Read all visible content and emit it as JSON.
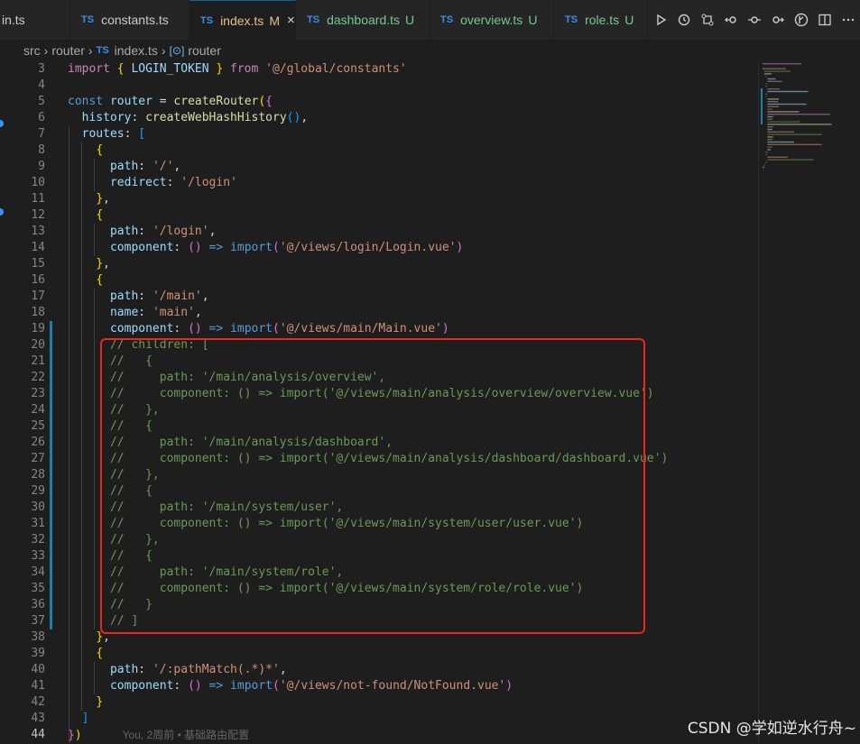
{
  "tabs": [
    {
      "name": "in.ts",
      "prefix": "",
      "status": "",
      "status_color": "#cccccc",
      "active": false
    },
    {
      "name": "constants.ts",
      "prefix": "TS",
      "status": "",
      "status_color": "#cccccc",
      "active": false
    },
    {
      "name": "index.ts",
      "prefix": "TS",
      "status": "M",
      "status_color": "#e2c08d",
      "active": true
    },
    {
      "name": "dashboard.ts",
      "prefix": "TS",
      "status": "U",
      "status_color": "#73c991",
      "active": false
    },
    {
      "name": "overview.ts",
      "prefix": "TS",
      "status": "U",
      "status_color": "#73c991",
      "active": false
    },
    {
      "name": "role.ts",
      "prefix": "TS",
      "status": "U",
      "status_color": "#73c991",
      "active": false
    }
  ],
  "tab_close": "×",
  "breadcrumb": {
    "folder1": "src",
    "folder2": "router",
    "file_prefix": "TS",
    "file": "index.ts",
    "symbol_icon": "[⊙]",
    "symbol": "router"
  },
  "toolbar": [
    "run-icon",
    "history-icon",
    "compare-icon",
    "back-icon",
    "commit-icon",
    "forward-icon",
    "git-graph-icon",
    "split-icon",
    "more-icon"
  ],
  "lines": [
    {
      "n": "3",
      "t": [
        [
          "kw",
          "import "
        ],
        [
          "b1",
          "{ "
        ],
        [
          "v",
          "LOGIN_TOKEN"
        ],
        [
          "b1",
          " }"
        ],
        [
          "kw",
          " from "
        ],
        [
          "s",
          "'@/global/constants'"
        ]
      ]
    },
    {
      "n": "4",
      "t": []
    },
    {
      "n": "5",
      "t": [
        [
          "k",
          "const "
        ],
        [
          "v",
          "router"
        ],
        [
          "p",
          " = "
        ],
        [
          "f",
          "createRouter"
        ],
        [
          "b1",
          "("
        ],
        [
          "b2",
          "{"
        ]
      ]
    },
    {
      "n": "6",
      "t": [
        [
          "p",
          "  "
        ],
        [
          "v",
          "history"
        ],
        [
          "p",
          ": "
        ],
        [
          "f",
          "createWebHashHistory"
        ],
        [
          "b3",
          "()"
        ],
        [
          "p",
          ","
        ]
      ]
    },
    {
      "n": "7",
      "t": [
        [
          "p",
          "  "
        ],
        [
          "v",
          "routes"
        ],
        [
          "p",
          ": "
        ],
        [
          "b3",
          "["
        ]
      ]
    },
    {
      "n": "8",
      "t": [
        [
          "p",
          "    "
        ],
        [
          "b1",
          "{"
        ]
      ]
    },
    {
      "n": "9",
      "t": [
        [
          "p",
          "      "
        ],
        [
          "v",
          "path"
        ],
        [
          "p",
          ": "
        ],
        [
          "s",
          "'/'"
        ],
        [
          "p",
          ","
        ]
      ]
    },
    {
      "n": "10",
      "t": [
        [
          "p",
          "      "
        ],
        [
          "v",
          "redirect"
        ],
        [
          "p",
          ": "
        ],
        [
          "s",
          "'/login'"
        ]
      ]
    },
    {
      "n": "11",
      "t": [
        [
          "p",
          "    "
        ],
        [
          "b1",
          "}"
        ],
        [
          "p",
          ","
        ]
      ]
    },
    {
      "n": "12",
      "t": [
        [
          "p",
          "    "
        ],
        [
          "b1",
          "{"
        ]
      ]
    },
    {
      "n": "13",
      "t": [
        [
          "p",
          "      "
        ],
        [
          "v",
          "path"
        ],
        [
          "p",
          ": "
        ],
        [
          "s",
          "'/login'"
        ],
        [
          "p",
          ","
        ]
      ]
    },
    {
      "n": "14",
      "t": [
        [
          "p",
          "      "
        ],
        [
          "v",
          "component"
        ],
        [
          "p",
          ": "
        ],
        [
          "b2",
          "()"
        ],
        [
          "k",
          " => "
        ],
        [
          "k",
          "import"
        ],
        [
          "b2",
          "("
        ],
        [
          "s",
          "'@/views/login/Login.vue'"
        ],
        [
          "b2",
          ")"
        ]
      ]
    },
    {
      "n": "15",
      "t": [
        [
          "p",
          "    "
        ],
        [
          "b1",
          "}"
        ],
        [
          "p",
          ","
        ]
      ]
    },
    {
      "n": "16",
      "t": [
        [
          "p",
          "    "
        ],
        [
          "b1",
          "{"
        ]
      ]
    },
    {
      "n": "17",
      "t": [
        [
          "p",
          "      "
        ],
        [
          "v",
          "path"
        ],
        [
          "p",
          ": "
        ],
        [
          "s",
          "'/main'"
        ],
        [
          "p",
          ","
        ]
      ]
    },
    {
      "n": "18",
      "t": [
        [
          "p",
          "      "
        ],
        [
          "v",
          "name"
        ],
        [
          "p",
          ": "
        ],
        [
          "s",
          "'main'"
        ],
        [
          "p",
          ","
        ]
      ]
    },
    {
      "n": "19",
      "t": [
        [
          "p",
          "      "
        ],
        [
          "v",
          "component"
        ],
        [
          "p",
          ": "
        ],
        [
          "b2",
          "()"
        ],
        [
          "k",
          " => "
        ],
        [
          "k",
          "import"
        ],
        [
          "b2",
          "("
        ],
        [
          "s",
          "'@/views/main/Main.vue'"
        ],
        [
          "b2",
          ")"
        ]
      ]
    },
    {
      "n": "20",
      "t": [
        [
          "p",
          "      "
        ],
        [
          "c",
          "// children: ["
        ]
      ]
    },
    {
      "n": "21",
      "t": [
        [
          "p",
          "      "
        ],
        [
          "c",
          "//   {"
        ]
      ]
    },
    {
      "n": "22",
      "t": [
        [
          "p",
          "      "
        ],
        [
          "c",
          "//     path: '/main/analysis/overview',"
        ]
      ]
    },
    {
      "n": "23",
      "t": [
        [
          "p",
          "      "
        ],
        [
          "c",
          "//     component: () => import('@/views/main/analysis/overview/overview.vue')"
        ]
      ]
    },
    {
      "n": "24",
      "t": [
        [
          "p",
          "      "
        ],
        [
          "c",
          "//   },"
        ]
      ]
    },
    {
      "n": "25",
      "t": [
        [
          "p",
          "      "
        ],
        [
          "c",
          "//   {"
        ]
      ]
    },
    {
      "n": "26",
      "t": [
        [
          "p",
          "      "
        ],
        [
          "c",
          "//     path: '/main/analysis/dashboard',"
        ]
      ]
    },
    {
      "n": "27",
      "t": [
        [
          "p",
          "      "
        ],
        [
          "c",
          "//     component: () => import('@/views/main/analysis/dashboard/dashboard.vue')"
        ]
      ]
    },
    {
      "n": "28",
      "t": [
        [
          "p",
          "      "
        ],
        [
          "c",
          "//   },"
        ]
      ]
    },
    {
      "n": "29",
      "t": [
        [
          "p",
          "      "
        ],
        [
          "c",
          "//   {"
        ]
      ]
    },
    {
      "n": "30",
      "t": [
        [
          "p",
          "      "
        ],
        [
          "c",
          "//     path: '/main/system/user',"
        ]
      ]
    },
    {
      "n": "31",
      "t": [
        [
          "p",
          "      "
        ],
        [
          "c",
          "//     component: () => import('@/views/main/system/user/user.vue')"
        ]
      ]
    },
    {
      "n": "32",
      "t": [
        [
          "p",
          "      "
        ],
        [
          "c",
          "//   },"
        ]
      ]
    },
    {
      "n": "33",
      "t": [
        [
          "p",
          "      "
        ],
        [
          "c",
          "//   {"
        ]
      ]
    },
    {
      "n": "34",
      "t": [
        [
          "p",
          "      "
        ],
        [
          "c",
          "//     path: '/main/system/role',"
        ]
      ]
    },
    {
      "n": "35",
      "t": [
        [
          "p",
          "      "
        ],
        [
          "c",
          "//     component: () => import('@/views/main/system/role/role.vue')"
        ]
      ]
    },
    {
      "n": "36",
      "t": [
        [
          "p",
          "      "
        ],
        [
          "c",
          "//   }"
        ]
      ]
    },
    {
      "n": "37",
      "t": [
        [
          "p",
          "      "
        ],
        [
          "c",
          "// ]"
        ]
      ]
    },
    {
      "n": "38",
      "t": [
        [
          "p",
          "    "
        ],
        [
          "b1",
          "}"
        ],
        [
          "p",
          ","
        ]
      ]
    },
    {
      "n": "39",
      "t": [
        [
          "p",
          "    "
        ],
        [
          "b1",
          "{"
        ]
      ]
    },
    {
      "n": "40",
      "t": [
        [
          "p",
          "      "
        ],
        [
          "v",
          "path"
        ],
        [
          "p",
          ": "
        ],
        [
          "s",
          "'/:pathMatch(.*)*'"
        ],
        [
          "p",
          ","
        ]
      ]
    },
    {
      "n": "41",
      "t": [
        [
          "p",
          "      "
        ],
        [
          "v",
          "component"
        ],
        [
          "p",
          ": "
        ],
        [
          "b2",
          "()"
        ],
        [
          "k",
          " => "
        ],
        [
          "k",
          "import"
        ],
        [
          "b2",
          "("
        ],
        [
          "s",
          "'@/views/not-found/NotFound.vue'"
        ],
        [
          "b2",
          ")"
        ]
      ]
    },
    {
      "n": "42",
      "t": [
        [
          "p",
          "    "
        ],
        [
          "b1",
          "}"
        ]
      ]
    },
    {
      "n": "43",
      "t": [
        [
          "p",
          "  "
        ],
        [
          "b3",
          "]"
        ]
      ]
    },
    {
      "n": "44",
      "t": [
        [
          "b2",
          "}"
        ],
        [
          "b1",
          ")"
        ]
      ]
    }
  ],
  "current_line": "44",
  "blame": "You, 2周前 • 基础路由配置",
  "watermark": "CSDN @学如逆水行舟~"
}
